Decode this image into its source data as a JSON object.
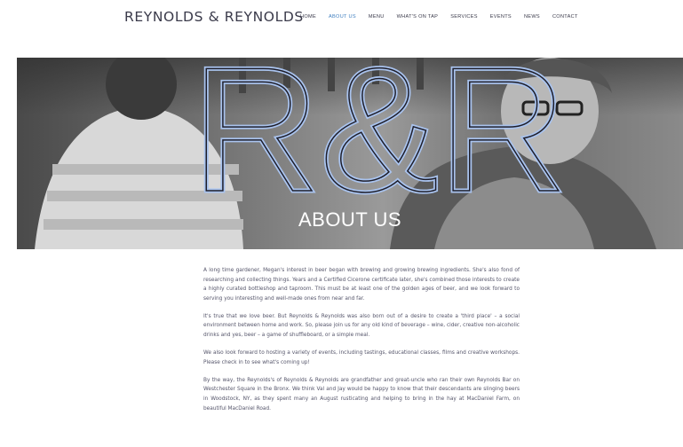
{
  "header": {
    "logo": "REYNOLDS & REYNOLDS",
    "nav": [
      {
        "label": "HOME"
      },
      {
        "label": "ABOUT US",
        "active": true
      },
      {
        "label": "MENU"
      },
      {
        "label": "WHAT'S ON TAP"
      },
      {
        "label": "SERVICES"
      },
      {
        "label": "EVENTS"
      },
      {
        "label": "NEWS"
      },
      {
        "label": "CONTACT"
      }
    ]
  },
  "hero": {
    "monogram": "R&R",
    "title": "ABOUT US"
  },
  "content": {
    "paragraphs": [
      "A long time gardener, Megan's interest in beer began with brewing and growing brewing ingredients. She's also fond of researching and collecting things. Years and a Certified Cicerone certificate later, she's combined those interests to create a highly curated bottleshop and taproom. This must be at least one of the golden ages of beer, and we look forward to serving you interesting and well-made ones from near and far.",
      "It's true that we love beer. But Reynolds & Reynolds was also born out of a desire to create a 'third place' – a social environment between home and work. So, please join us for any old kind of beverage – wine, cider, creative non-alcoholic drinks and yes, beer – a game of shuffleboard, or a simple meal.",
      "We also look forward to hosting a variety of events, including tastings, educational classes, films and creative workshops. Please check in to see what's coming up!",
      "By the way, the Reynolds's of Reynolds & Reynolds are grandfather and great-uncle who ran their own Reynolds Bar on Westchester Square in the Bronx. We think Val and Jay would be happy to know that their descendants are slinging beers in Woodstock, NY, as they spent many an August rusticating and helping to bring in the hay at MacDaniel Farm, on beautiful MacDaniel Road."
    ]
  },
  "colors": {
    "accent": "#3f7fc0",
    "monogram_stroke": "#a9c3ee",
    "text": "#55556a"
  }
}
